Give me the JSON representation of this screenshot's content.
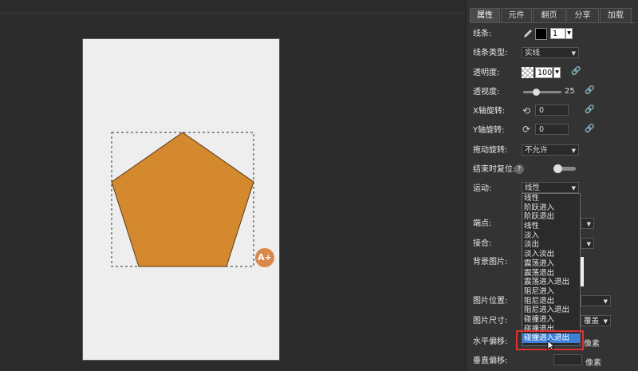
{
  "tabs": [
    {
      "label": "属性"
    },
    {
      "label": "元件"
    },
    {
      "label": "翻页"
    },
    {
      "label": "分享"
    },
    {
      "label": "加载"
    }
  ],
  "props": {
    "line": {
      "label": "线条:",
      "width_value": "1"
    },
    "line_type": {
      "label": "线条类型:",
      "value": "实线"
    },
    "opacity": {
      "label": "透明度:",
      "value": "100"
    },
    "perspective": {
      "label": "透视度:",
      "value": "25",
      "level_fraction": 0.25
    },
    "x_rotate": {
      "label": "X轴旋转:",
      "value": "0"
    },
    "y_rotate": {
      "label": "Y轴旋转:",
      "value": "0"
    },
    "drag_rotate": {
      "label": "拖动旋转:",
      "value": "不允许"
    },
    "end_reset": {
      "label": "结束时复位:",
      "help": "?",
      "toggle_on": false
    },
    "motion": {
      "label": "运动:",
      "value": "线性"
    },
    "endpoint": {
      "label": "端点:"
    },
    "join": {
      "label": "接合:"
    },
    "bg_image": {
      "label": "背景图片:"
    },
    "image_position": {
      "label": "图片位置:"
    },
    "image_size": {
      "label": "图片尺寸:",
      "value_partial": "覆盖"
    },
    "h_offset": {
      "label": "水平偏移:",
      "unit": "像素"
    },
    "v_offset": {
      "label": "垂直偏移:",
      "unit": "像素"
    }
  },
  "motion_options": [
    "线性",
    "阶跃进入",
    "阶跃退出",
    "线性",
    "淡入",
    "淡出",
    "淡入淡出",
    "震荡进入",
    "震荡退出",
    "震荡进入退出",
    "阻尼进入",
    "阻尼退出",
    "阻尼进入退出",
    "碰撞进入",
    "碰撞退出",
    "碰撞进入退出"
  ],
  "motion_selected_index": 15,
  "badge_text": "A+",
  "colors": {
    "shape_fill": "#d4892f",
    "accent_selected": "#3d7fd6",
    "highlight": "#e03030",
    "badge": "#d9884a"
  }
}
